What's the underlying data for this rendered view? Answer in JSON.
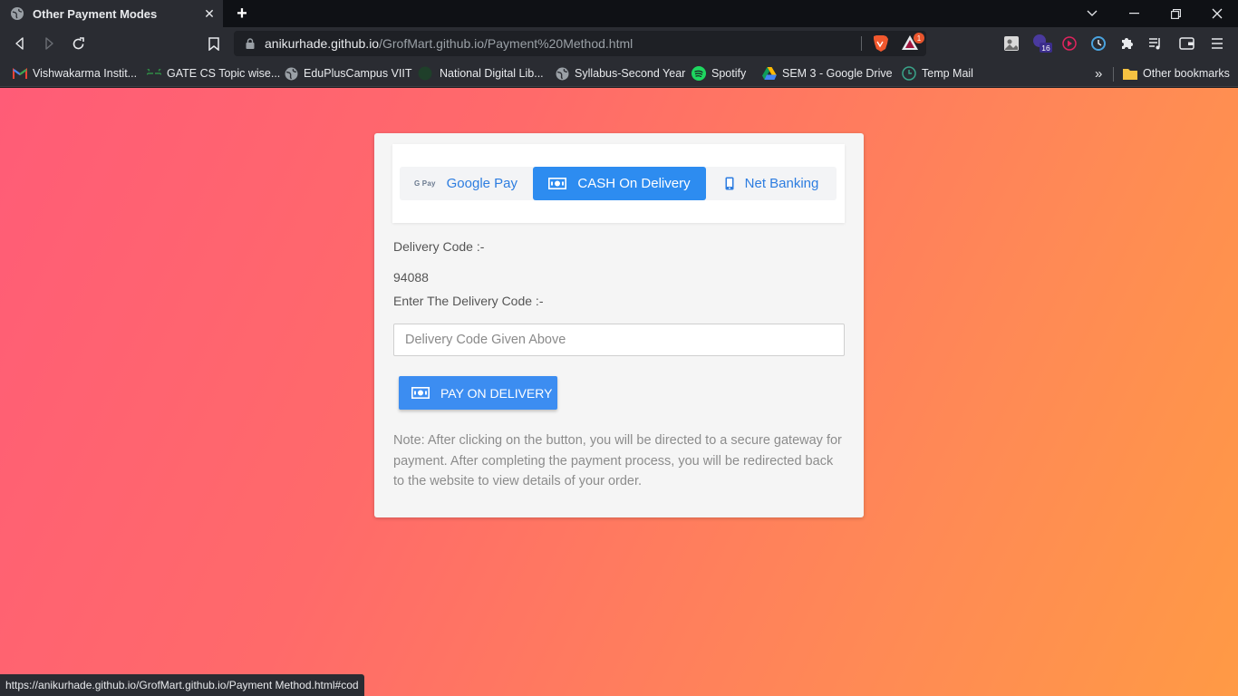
{
  "browser": {
    "tab_title": "Other Payment Modes",
    "tab_close_icon": "close-icon",
    "new_tab_label": "+",
    "window_controls": [
      "chevron-down-icon",
      "minimize-icon",
      "restore-icon",
      "close-icon"
    ],
    "url_host": "anikurhade.github.io",
    "url_path": "/GrofMart.github.io/Payment%20Method.html",
    "rewards_badge": "1",
    "extension_badge": "16",
    "status_url": "https://anikurhade.github.io/GrofMart.github.io/Payment Method.html#cod"
  },
  "bookmarks": {
    "items": [
      {
        "label": "Vishwakarma Instit...",
        "icon": "gmail-icon"
      },
      {
        "label": "GATE CS Topic wise...",
        "icon": "gfg-icon"
      },
      {
        "label": "EduPlusCampus VIIT",
        "icon": "globe-icon"
      },
      {
        "label": "National Digital Lib...",
        "icon": "ndl-icon"
      },
      {
        "label": "Syllabus-Second Year",
        "icon": "globe-icon"
      },
      {
        "label": "Spotify",
        "icon": "spotify-icon"
      },
      {
        "label": "SEM 3 - Google Drive",
        "icon": "drive-icon"
      },
      {
        "label": "Temp Mail",
        "icon": "tempmail-icon"
      }
    ],
    "overflow_label": "»",
    "other_bookmarks": "Other bookmarks"
  },
  "payment": {
    "tabs": [
      {
        "label": "Google Pay",
        "icon_text": "G Pay",
        "active": false
      },
      {
        "label": "CASH On Delivery",
        "active": true
      },
      {
        "label": "Net Banking",
        "active": false
      }
    ],
    "delivery_code_label": "Delivery Code :-",
    "delivery_code_value": "94088",
    "enter_code_label": "Enter The Delivery Code :-",
    "input_placeholder": "Delivery Code Given Above",
    "input_value": "",
    "pay_button_label": "PAY ON DELIVERY",
    "note": "Note: After clicking on the button, you will be directed to a secure gateway for payment. After completing the payment process, you will be redirected back to the website to view details of your order."
  },
  "colors": {
    "accent": "#2d8cf0",
    "page_gradient_start": "#ff5c77",
    "page_gradient_end": "#ff9a45"
  }
}
